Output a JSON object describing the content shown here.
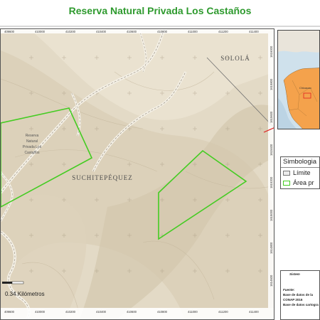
{
  "title": "Reserva Natural Privada Los Castaños",
  "map": {
    "regions": [
      "SOLOLÁ",
      "SUCHITEPÉQUEZ"
    ],
    "reserve_label_lines": [
      "Reserva",
      "Natural",
      "Privada Los",
      "Castaños"
    ],
    "scale_label": "0.34 Kilómetros",
    "x_ticks_top": [
      "409600",
      "410000",
      "410200",
      "410400",
      "410600",
      "410800",
      "411000",
      "411200",
      "411400"
    ],
    "x_ticks_bottom": [
      "409600",
      "410000",
      "410200",
      "410400",
      "410600",
      "410800",
      "411000",
      "411200",
      "411400"
    ],
    "y_ticks_right": [
      "1616000",
      "1615800",
      "1615600",
      "1615400",
      "1615200",
      "1615000",
      "1614800",
      "1614600"
    ],
    "colors": {
      "protected_area": "#44cc22",
      "background": "#e2d8c3",
      "inset_land": "#f4a24c",
      "connector": "#e02020"
    }
  },
  "inset": {
    "place_label": "Chicacao"
  },
  "legend": {
    "title": "Simbologia",
    "items": [
      {
        "label": "Límite",
        "swatch": "boundary"
      },
      {
        "label": "Área pr",
        "swatch": "protected-area"
      }
    ]
  },
  "source": {
    "system": "Sistem",
    "heading": "Fuente:",
    "lines": [
      "Base de datos de la",
      "CONAP 2016",
      "Base de datos cartogra"
    ]
  }
}
